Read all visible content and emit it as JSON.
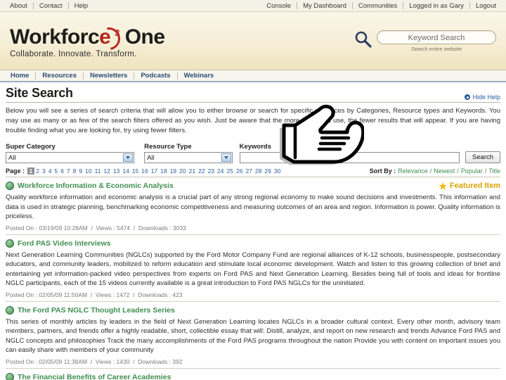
{
  "topbar": {
    "left_links": [
      "About",
      "Contact",
      "Help"
    ],
    "right_links": [
      "Console",
      "My Dashboard",
      "Communities",
      "Logged in as Gary",
      "Logout"
    ]
  },
  "banner": {
    "logo_part1": "Workforc",
    "logo_e": "e",
    "logo_sup": "3",
    "logo_part2": "One",
    "tagline": "Collaborate.  Innovate.  Transform.",
    "search_value": "Keyword Search",
    "search_sub": "Search entire website",
    "search_icon": "magnifier-icon"
  },
  "mainnav": {
    "items": [
      "Home",
      "Resources",
      "Newsletters",
      "Podcasts",
      "Webinars"
    ]
  },
  "page": {
    "title": "Site Search",
    "hide_help": "Hide Help",
    "help_text": "Below you will see a series of search criteria that will allow you to either browse or search for specific resources by Categories, Resource types and Keywords. You may use as many or as few of the search filters offered as you wish. Just be aware that the more filters you use, the fewer results that will appear. If you are having trouble finding what you are looking for, try using fewer filters."
  },
  "filters": {
    "super_category_label": "Super Category",
    "super_category_value": "All",
    "resource_type_label": "Resource Type",
    "resource_type_value": "All",
    "keywords_label": "Keywords",
    "keywords_value": "",
    "keywords_placeholder": "",
    "search_button": "Search"
  },
  "pager": {
    "label": "Page :",
    "current": "1",
    "pages": [
      "2",
      "3",
      "4",
      "5",
      "6",
      "7",
      "8",
      "9",
      "10",
      "11",
      "12",
      "13",
      "14",
      "15",
      "16",
      "17",
      "18",
      "19",
      "20",
      "21",
      "22",
      "23",
      "24",
      "25",
      "26",
      "27",
      "28",
      "29",
      "30"
    ],
    "sort_label": "Sort By :",
    "sort_options": [
      "Relevance",
      "Newest",
      "Popular",
      "Title"
    ]
  },
  "results": [
    {
      "title": "Workforce Information & Economic Analysis",
      "featured_label": "Featured Item",
      "featured": true,
      "description": "Quality workforce information and economic analysis is a crucial part of any strong regional economy to make sound decisions and investments. This information and data is used in strategic planning, benchmarking economic competitiveness and measuring outcomes of an area and region. Information is power. Quality information is priceless.",
      "posted_on": "Posted On : 03/19/09 10:28AM",
      "views": "Views : 5474",
      "downloads": "Downloads : 3033"
    },
    {
      "title": "Ford PAS Video Interviews",
      "featured": false,
      "description": "Next Generation Learning Communities (NGLCs) supported by the Ford Motor Company Fund are regional alliances of K-12 schools, businesspeople, postsecondary educators, and community leaders, mobilized to reform education and stimulate local economic development. Watch and listen to this growing collection of brief and entertaining yet information-packed video perspectives from experts on Ford PAS and Next Generation Learning. Besides being full of tools and ideas for frontline NGLC participants, each of the 15 videos currently available is a great introduction to Ford PAS NGLCs for the uninitiated.",
      "posted_on": "Posted On : 02/05/09 11:50AM",
      "views": "Views : 1472",
      "downloads": "Downloads : 423"
    },
    {
      "title": "The Ford PAS NGLC Thought Leaders Series",
      "featured": false,
      "description": "This series of monthly articles by leaders in the field of Next Generation Learning locates NGLCs in a broader cultural context. Every other month, advisory team members, partners, and friends offer a highly readable, short, collectible essay that will: Distill, analyze, and report on new research and trends Advance Ford PAS and NGLC concepts and philosophies Track the many accomplishments of the Ford PAS programs throughout the nation Provide you with content on important issues you can easily share with members of your community",
      "posted_on": "Posted On : 02/05/09 11:38AM",
      "views": "Views : 1430",
      "downloads": "Downloads : 392"
    },
    {
      "title": "The Financial Benefits of Career Academies",
      "featured": false,
      "description": "",
      "posted_on": "",
      "views": "",
      "downloads": ""
    }
  ],
  "overlay": {
    "cursor": "pointing-hand-cursor"
  },
  "colors": {
    "brand_red": "#b5271e",
    "link_blue": "#2a5c9a",
    "result_green": "#3f8f4f",
    "featured_gold": "#d9a400",
    "banner_cream": "#f6eed6"
  }
}
